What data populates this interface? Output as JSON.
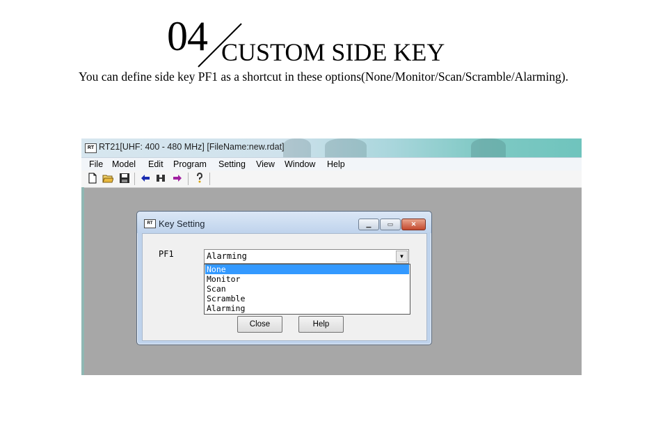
{
  "hero": {
    "number": "04",
    "title": "CUSTOM SIDE KEY",
    "subtitle": "You can define side key PF1 as a shortcut in these options(None/Monitor/Scan/Scramble/Alarming)."
  },
  "app": {
    "window_title": "RT21[UHF: 400 - 480 MHz] [FileName:new.rdat]",
    "menu": [
      "File",
      "Model",
      "Edit",
      "Program",
      "Setting",
      "View",
      "Window",
      "Help"
    ]
  },
  "dialog": {
    "title": "Key Setting",
    "field_label": "PF1",
    "selected_value": "Alarming",
    "options": [
      "None",
      "Monitor",
      "Scan",
      "Scramble",
      "Alarming"
    ],
    "highlighted_option": "None",
    "close_button": "Close",
    "help_button": "Help"
  },
  "colors": {
    "highlight": "#3399ff",
    "workspace": "#a7a7a7"
  }
}
